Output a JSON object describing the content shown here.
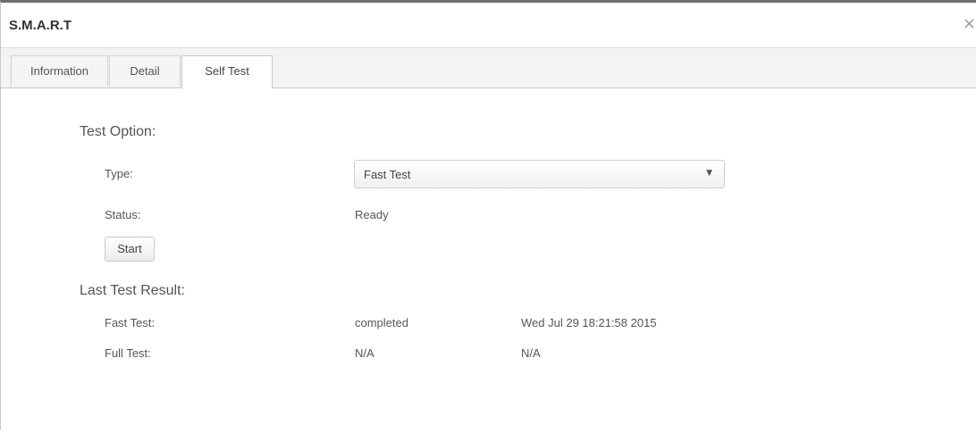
{
  "dialog": {
    "title": "S.M.A.R.T",
    "close_symbol": "×"
  },
  "tabs": [
    {
      "label": "Information",
      "active": false
    },
    {
      "label": "Detail",
      "active": false
    },
    {
      "label": "Self Test",
      "active": true
    }
  ],
  "test_option": {
    "heading": "Test Option:",
    "type_label": "Type:",
    "type_value": "Fast Test",
    "status_label": "Status:",
    "status_value": "Ready",
    "start_button": "Start"
  },
  "last_result": {
    "heading": "Last Test Result:",
    "rows": [
      {
        "name": "Fast Test:",
        "result": "completed",
        "time": "Wed Jul 29 18:21:58 2015"
      },
      {
        "name": "Full Test:",
        "result": "N/A",
        "time": "N/A"
      }
    ]
  },
  "icons": {
    "dropdown": "chevron-down-icon",
    "close": "close-icon"
  }
}
